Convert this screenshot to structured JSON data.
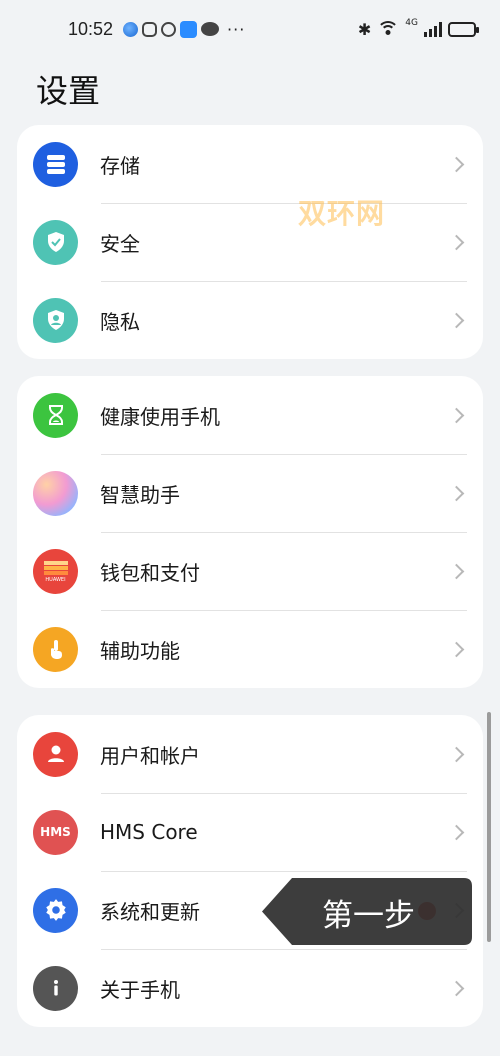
{
  "status_bar": {
    "time": "10:52",
    "dots": "···",
    "network": "4G"
  },
  "page": {
    "title": "设置"
  },
  "groups": [
    {
      "items": [
        {
          "label": "存储",
          "icon": "storage-icon",
          "color": "#1f5fe0"
        },
        {
          "label": "安全",
          "icon": "shield-check-icon",
          "color": "#4fc3b4"
        },
        {
          "label": "隐私",
          "icon": "privacy-shield-icon",
          "color": "#4fc3b4"
        }
      ]
    },
    {
      "items": [
        {
          "label": "健康使用手机",
          "icon": "hourglass-icon",
          "color": "#3cc43f"
        },
        {
          "label": "智慧助手",
          "icon": "smart-assistant-icon",
          "color": "#c58ef0"
        },
        {
          "label": "钱包和支付",
          "icon": "wallet-icon",
          "color": "#e8453c",
          "icon_text": "HUAWEI"
        },
        {
          "label": "辅助功能",
          "icon": "hand-tap-icon",
          "color": "#f5a623"
        }
      ]
    },
    {
      "items": [
        {
          "label": "用户和帐户",
          "icon": "user-icon",
          "color": "#e8453c"
        },
        {
          "label": "HMS Core",
          "icon": "hms-core-icon",
          "color": "#e05252",
          "icon_text": "HMS"
        },
        {
          "label": "系统和更新",
          "icon": "gear-icon",
          "color": "#2f6fe6"
        },
        {
          "label": "关于手机",
          "icon": "info-icon",
          "color": "#555555"
        }
      ]
    }
  ],
  "watermark": "双环网",
  "tooltip": {
    "text": "第一步",
    "color": "#2e2e2e"
  }
}
